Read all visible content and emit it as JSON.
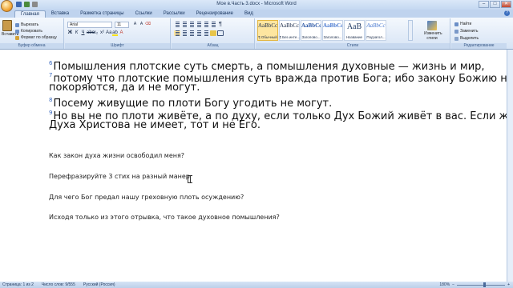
{
  "window": {
    "title": "Мое в.Часть 3.docx - Microsoft Word",
    "controls": [
      "–",
      "□",
      "✕"
    ]
  },
  "tabs": [
    "Главная",
    "Вставка",
    "Разметка страницы",
    "Ссылки",
    "Рассылки",
    "Рецензирование",
    "Вид"
  ],
  "ribbon": {
    "clipboard": {
      "paste": "Вставить",
      "cut": "Вырезать",
      "copy": "Копировать",
      "format_painter": "Формат по образцу",
      "label": "Буфер обмена"
    },
    "font": {
      "name": "Arial",
      "size": "11",
      "label": "Шрифт"
    },
    "paragraph": {
      "label": "Абзац"
    },
    "styles": {
      "items": [
        {
          "preview": "AaBbCcDc",
          "name": "¶ Обычный"
        },
        {
          "preview": "AaBbCcDc",
          "name": "¶ Без инте..."
        },
        {
          "preview": "AaBbCc",
          "name": "Заголово..."
        },
        {
          "preview": "AaBbCc",
          "name": "Заголово..."
        },
        {
          "preview": "AaB",
          "name": "Название"
        },
        {
          "preview": "AaBbCc",
          "name": "Подзагол..."
        }
      ],
      "change": "Изменить стили",
      "label": "Стили"
    },
    "editing": {
      "find": "Найти",
      "replace": "Заменить",
      "select": "Выделить",
      "label": "Редактирование"
    }
  },
  "document": {
    "verses": [
      {
        "num": "6",
        "text": "Помышления плотские суть смерть, а помышления духовные — жизнь и мир,"
      },
      {
        "num": "7",
        "text": "потому что плотские помышления суть вражда против Бога; ибо закону Божию не"
      },
      {
        "num": "",
        "text": "покоряются, да и не могут."
      },
      {
        "num": "8",
        "text": "Посему живущие по плоти Богу угодить не могут."
      },
      {
        "num": "9",
        "text": "Но вы не по плоти живёте, а по духу, если только Дух Божий живёт в вас. Если же кто"
      },
      {
        "num": "",
        "text": "Духа Христова не имеет, тот и не Его."
      }
    ],
    "questions": [
      "Как закон духа жизни освободил меня?",
      "Перефразируйте 3 стих на разный манер",
      "Для чего Бог предал нашу греховную плоть осуждению?",
      "Исходя только из этого отрывка, что такое духовное помышления?"
    ]
  },
  "status": {
    "page": "Страница: 1 из 2",
    "words": "Число слов: 9/555",
    "language": "Русский (Россия)",
    "zoom": "180%",
    "zoom_level": 0.55
  }
}
